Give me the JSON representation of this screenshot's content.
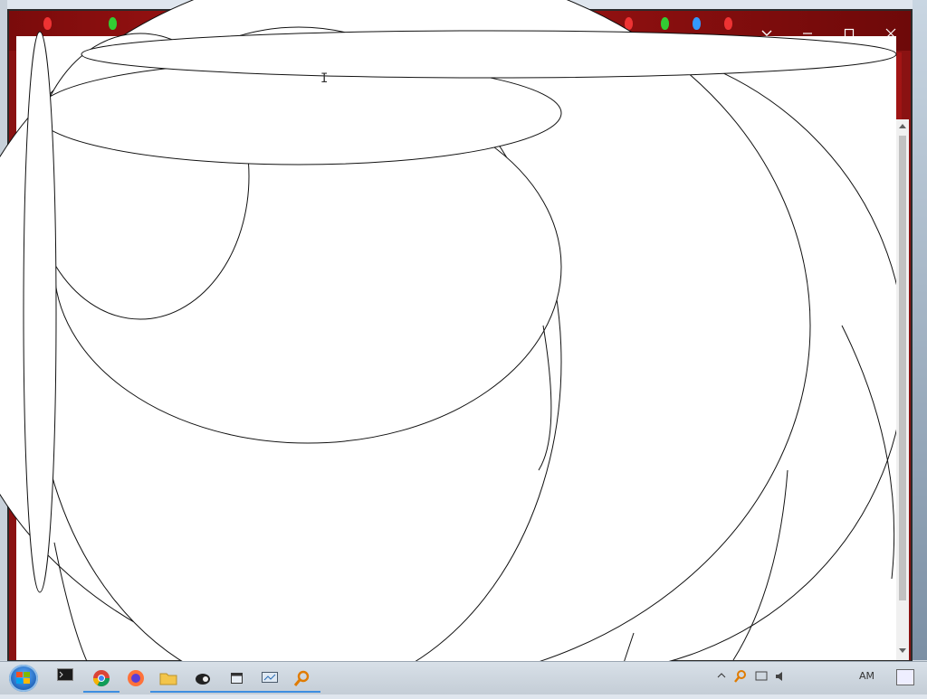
{
  "window": {
    "theme_color": "#8a1212",
    "accent": "#b21818",
    "controls": [
      {
        "name": "tab-search-button",
        "icon": "chevron-down-icon"
      },
      {
        "name": "minimize-button",
        "icon": "minimize-icon"
      },
      {
        "name": "maximize-button",
        "icon": "maximize-icon"
      },
      {
        "name": "close-button",
        "icon": "close-icon"
      }
    ]
  },
  "content": {
    "cursor_glyph": "I",
    "apps_icon": "apps-grid-icon"
  },
  "taskbar": {
    "start_icon": "windows-start-icon",
    "items": [
      {
        "name": "taskbar-item-cmd",
        "glyph": "⌨",
        "icon": "console-icon"
      },
      {
        "name": "taskbar-item-chrome",
        "glyph": "",
        "icon": "chrome-icon"
      },
      {
        "name": "taskbar-item-firefox",
        "glyph": "",
        "icon": "firefox-icon"
      },
      {
        "name": "taskbar-item-explorer",
        "glyph": "",
        "icon": "folder-icon"
      },
      {
        "name": "taskbar-item-tux",
        "glyph": "",
        "icon": "penguin-icon"
      },
      {
        "name": "taskbar-item-window",
        "glyph": "",
        "icon": "window-icon"
      },
      {
        "name": "taskbar-item-monitor",
        "glyph": "",
        "icon": "monitor-icon"
      },
      {
        "name": "taskbar-item-search",
        "glyph": "",
        "icon": "magnifier-icon"
      }
    ],
    "tray": {
      "clock": "АМ",
      "icons": [
        "chevron-up-icon",
        "magnifier-icon",
        "network-icon",
        "volume-icon",
        "notification-icon"
      ]
    }
  }
}
